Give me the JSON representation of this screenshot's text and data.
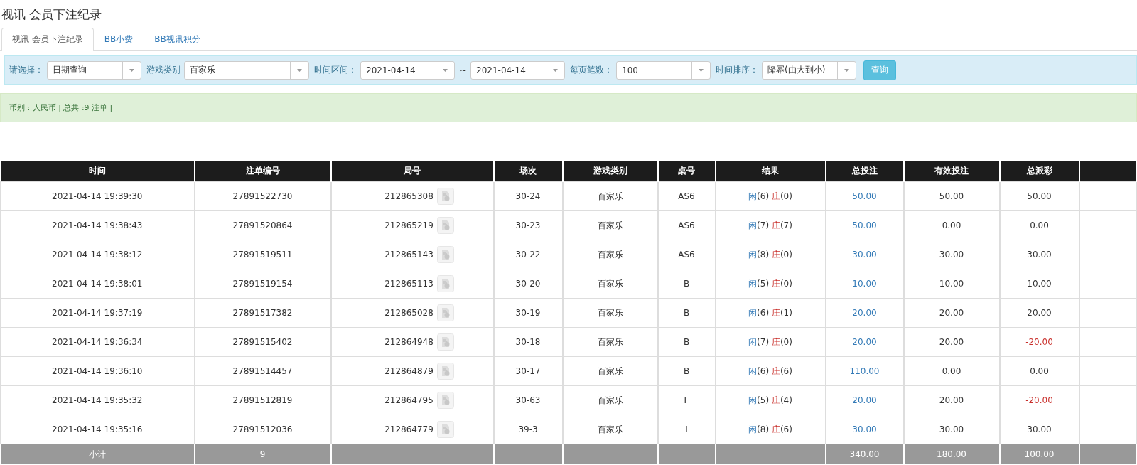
{
  "page_title": "视讯 会员下注纪录",
  "tabs": [
    {
      "label": "视讯 会员下注纪录",
      "selected": true
    },
    {
      "label": "BB小费",
      "selected": false
    },
    {
      "label": "BB视讯积分",
      "selected": false
    }
  ],
  "filters": [
    {
      "label": "请选择：",
      "value": "日期查询"
    },
    {
      "label": "游戏类别",
      "value": "百家乐"
    },
    {
      "label": "时间区间：",
      "value": "2021-04-14",
      "separator": "~",
      "value_to": "2021-04-14"
    },
    {
      "label": "每页笔数：",
      "value": "100"
    },
    {
      "label": "时间排序：",
      "value": "降幂(由大到小)"
    }
  ],
  "query_button": "查询",
  "summary": "币别 : 人民币 | 总共 :9 注单 |",
  "table": {
    "columns": [
      "时间",
      "注单编号",
      "局号",
      "场次",
      "游戏类别",
      "桌号",
      "结果",
      "总投注",
      "有效投注",
      "总派彩"
    ],
    "rows": [
      {
        "time": "2021-04-14 19:39:30",
        "bet_id": "27891522730",
        "round": "212865308",
        "session": "30-24",
        "game": "百家乐",
        "table": "AS6",
        "player": "闲",
        "player_points": "(6)",
        "banker": "庄",
        "banker_points": "(0)",
        "bet": "50.00",
        "valid": "50.00",
        "payout": "50.00",
        "loss": false
      },
      {
        "time": "2021-04-14 19:38:43",
        "bet_id": "27891520864",
        "round": "212865219",
        "session": "30-23",
        "game": "百家乐",
        "table": "AS6",
        "player": "闲",
        "player_points": "(7)",
        "banker": "庄",
        "banker_points": "(7)",
        "bet": "50.00",
        "valid": "0.00",
        "payout": "0.00",
        "loss": false
      },
      {
        "time": "2021-04-14 19:38:12",
        "bet_id": "27891519511",
        "round": "212865143",
        "session": "30-22",
        "game": "百家乐",
        "table": "AS6",
        "player": "闲",
        "player_points": "(8)",
        "banker": "庄",
        "banker_points": "(0)",
        "bet": "30.00",
        "valid": "30.00",
        "payout": "30.00",
        "loss": false
      },
      {
        "time": "2021-04-14 19:38:01",
        "bet_id": "27891519154",
        "round": "212865113",
        "session": "30-20",
        "game": "百家乐",
        "table": "B",
        "player": "闲",
        "player_points": "(5)",
        "banker": "庄",
        "banker_points": "(0)",
        "bet": "10.00",
        "valid": "10.00",
        "payout": "10.00",
        "loss": false
      },
      {
        "time": "2021-04-14 19:37:19",
        "bet_id": "27891517382",
        "round": "212865028",
        "session": "30-19",
        "game": "百家乐",
        "table": "B",
        "player": "闲",
        "player_points": "(6)",
        "banker": "庄",
        "banker_points": "(1)",
        "bet": "20.00",
        "valid": "20.00",
        "payout": "20.00",
        "loss": false
      },
      {
        "time": "2021-04-14 19:36:34",
        "bet_id": "27891515402",
        "round": "212864948",
        "session": "30-18",
        "game": "百家乐",
        "table": "B",
        "player": "闲",
        "player_points": "(7)",
        "banker": "庄",
        "banker_points": "(0)",
        "bet": "20.00",
        "valid": "20.00",
        "payout": "-20.00",
        "loss": true
      },
      {
        "time": "2021-04-14 19:36:10",
        "bet_id": "27891514457",
        "round": "212864879",
        "session": "30-17",
        "game": "百家乐",
        "table": "B",
        "player": "闲",
        "player_points": "(6)",
        "banker": "庄",
        "banker_points": "(6)",
        "bet": "110.00",
        "valid": "0.00",
        "payout": "0.00",
        "loss": false
      },
      {
        "time": "2021-04-14 19:35:32",
        "bet_id": "27891512819",
        "round": "212864795",
        "session": "30-63",
        "game": "百家乐",
        "table": "F",
        "player": "闲",
        "player_points": "(5)",
        "banker": "庄",
        "banker_points": "(4)",
        "bet": "20.00",
        "valid": "20.00",
        "payout": "-20.00",
        "loss": true
      },
      {
        "time": "2021-04-14 19:35:16",
        "bet_id": "27891512036",
        "round": "212864779",
        "session": "39-3",
        "game": "百家乐",
        "table": "I",
        "player": "闲",
        "player_points": "(8)",
        "banker": "庄",
        "banker_points": "(6)",
        "bet": "30.00",
        "valid": "30.00",
        "payout": "30.00",
        "loss": false
      }
    ],
    "subtotal": {
      "label": "小计",
      "count": "9",
      "bet": "340.00",
      "valid": "180.00",
      "payout": "100.00"
    }
  }
}
